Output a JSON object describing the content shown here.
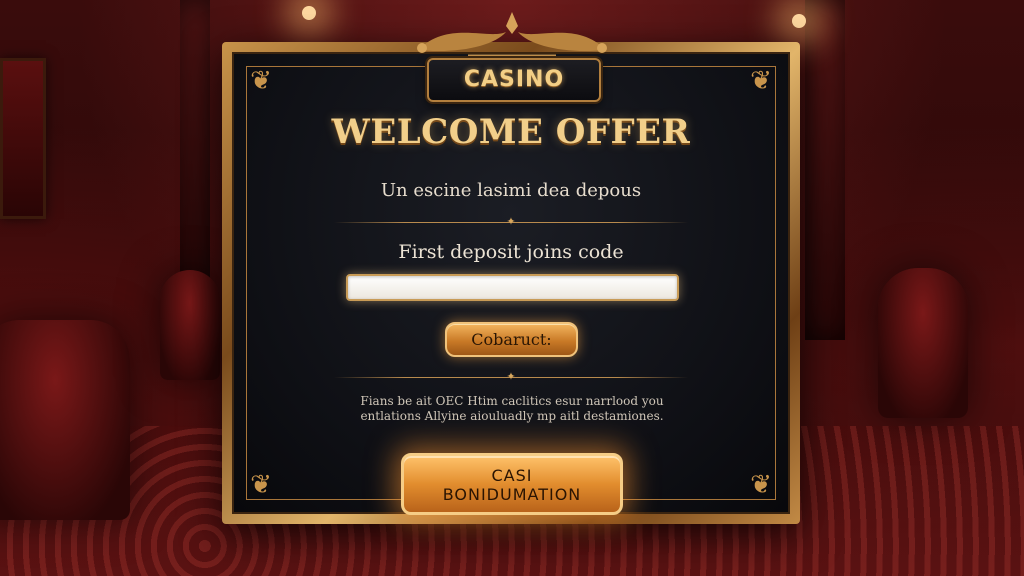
{
  "header": {
    "brand": "CASINO"
  },
  "offer": {
    "title": "WELCOME OFFER",
    "subtitle": "Un escine lasimi dea depous",
    "code_label": "First deposit joins code",
    "code_input_value": "",
    "contact_button": "Cobaruct:",
    "fineprint_lines": [
      "Fians be ait OEC Htim caclitics esur narrlood you",
      "entlations Allyine aiouluadly mp aitl destamiones."
    ],
    "cta_line1": "CASI",
    "cta_line2": "BONIDUMATION"
  },
  "colors": {
    "gold": "#f2cf8a",
    "frame": "#c8934a",
    "panel": "#0e0f14",
    "button": "#e28d2e",
    "background": "#3a0c0c"
  },
  "icons": {
    "corner": "ornament-icon",
    "divider": "diamond-ornament-icon",
    "crest": "filigree-crest-icon"
  }
}
